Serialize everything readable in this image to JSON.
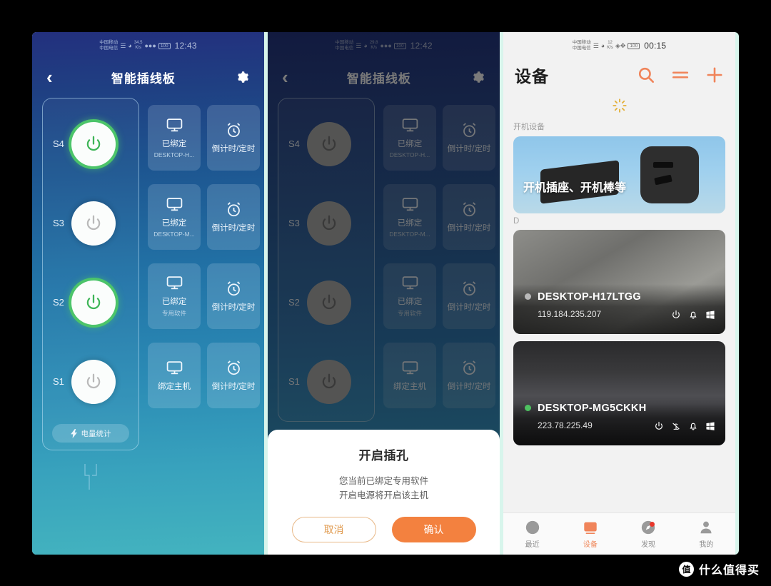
{
  "panel1": {
    "statusbar": {
      "carrier1": "中国移动",
      "carrier2": "中国电信",
      "hd": "HD",
      "net_speed": "34.5",
      "net_unit": "K/s",
      "battery": "100",
      "time": "12:43"
    },
    "navbar": {
      "back_icon": "chevron-left-icon",
      "title": "智能插线板",
      "gear_icon": "gear-icon"
    },
    "sockets": [
      {
        "label": "S4",
        "state": "on",
        "bind_main": "已绑定",
        "bind_sub": "DESKTOP-H...",
        "timer_label": "倒计时/定时"
      },
      {
        "label": "S3",
        "state": "off",
        "bind_main": "已绑定",
        "bind_sub": "DESKTOP-M...",
        "timer_label": "倒计时/定时"
      },
      {
        "label": "S2",
        "state": "on",
        "bind_main": "已绑定",
        "bind_sub": "专用软件",
        "timer_label": "倒计时/定时"
      },
      {
        "label": "S1",
        "state": "off",
        "bind_main": "绑定主机",
        "bind_sub": "",
        "timer_label": "倒计时/定时"
      }
    ],
    "energy_button": "电量统计",
    "energy_icon": "bolt-icon"
  },
  "panel2": {
    "statusbar": {
      "carrier1": "中国移动",
      "carrier2": "中国电信",
      "hd": "HD",
      "net_speed": "29.8",
      "net_unit": "K/s",
      "battery": "100",
      "time": "12:42"
    },
    "navbar": {
      "back_icon": "chevron-left-icon",
      "title": "智能插线板",
      "gear_icon": "gear-icon"
    },
    "sockets": [
      {
        "label": "S4",
        "state": "off",
        "bind_main": "已绑定",
        "bind_sub": "DESKTOP-H...",
        "timer_label": "倒计时/定时"
      },
      {
        "label": "S3",
        "state": "off",
        "bind_main": "已绑定",
        "bind_sub": "DESKTOP-M...",
        "timer_label": "倒计时/定时"
      },
      {
        "label": "S2",
        "state": "off",
        "bind_main": "已绑定",
        "bind_sub": "专用软件",
        "timer_label": "倒计时/定时"
      },
      {
        "label": "S1",
        "state": "off",
        "bind_main": "绑定主机",
        "bind_sub": "",
        "timer_label": "倒计时/定时"
      }
    ],
    "dialog": {
      "title": "开启插孔",
      "message_line1": "您当前已绑定专用软件",
      "message_line2": "开启电源将开启该主机",
      "cancel": "取消",
      "confirm": "确认"
    }
  },
  "panel3": {
    "statusbar": {
      "carrier1": "中国移动",
      "carrier2": "中国电信",
      "hd": "HD",
      "net_speed": "12",
      "net_unit": "K/s",
      "battery": "100",
      "time": "00:15"
    },
    "header": {
      "title": "设备",
      "search_icon": "search-icon",
      "list_icon": "list-icon",
      "add_icon": "plus-icon"
    },
    "loading_icon": "loading-spinner-icon",
    "section_label": "开机设备",
    "promo": {
      "caption": "开机插座、开机棒等"
    },
    "group_label": "D",
    "devices": [
      {
        "name": "DESKTOP-H17LTGG",
        "ip": "119.184.235.207",
        "status": "offline",
        "status_color": "#b9b9b9",
        "icons": [
          "power-icon",
          "bell-icon",
          "windows-icon"
        ]
      },
      {
        "name": "DESKTOP-MG5CKKH",
        "ip": "223.78.225.49",
        "status": "online",
        "status_color": "#4ec261",
        "icons": [
          "power-icon",
          "broadcast-off-icon",
          "bell-icon",
          "windows-icon"
        ]
      }
    ],
    "tabs": [
      {
        "label": "最近",
        "icon": "clock-icon",
        "active": false,
        "badge": false
      },
      {
        "label": "设备",
        "icon": "image-icon",
        "active": true,
        "badge": false
      },
      {
        "label": "发现",
        "icon": "compass-icon",
        "active": false,
        "badge": true
      },
      {
        "label": "我的",
        "icon": "person-icon",
        "active": false,
        "badge": false
      }
    ]
  },
  "watermark": {
    "mark": "值",
    "text": "什么值得买"
  },
  "colors": {
    "accent_orange": "#f3813f",
    "online_green": "#4ec261",
    "frame_mint": "#d8f5ec"
  }
}
